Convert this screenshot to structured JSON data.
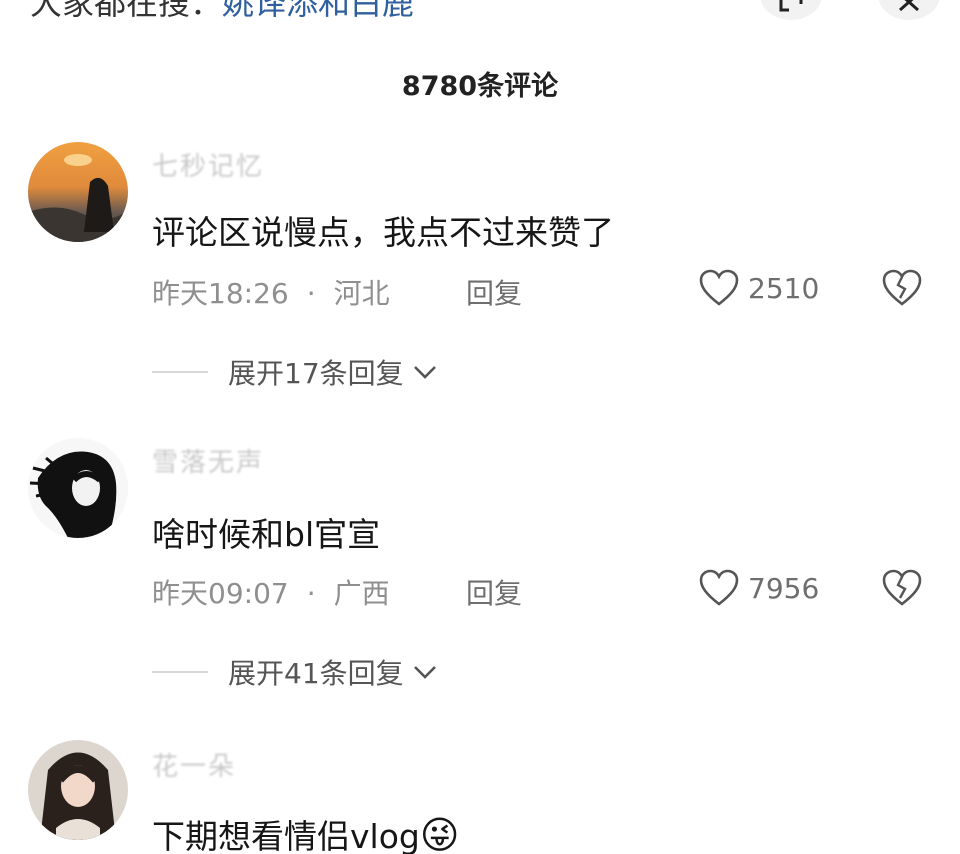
{
  "topbar": {
    "search_prefix": "大家都在搜：",
    "search_keyword": "姚译添和白鹿",
    "search_icon": "search-icon",
    "expand_icon": "expand-icon",
    "close_icon": "close-icon"
  },
  "comment_count": "8780条评论",
  "comments": [
    {
      "username": "七秒记忆",
      "text": "评论区说慢点，我点不过来赞了",
      "time": "昨天18:26",
      "location": "河北",
      "reply_label": "回复",
      "likes": "2510",
      "expand_label": "展开17条回复"
    },
    {
      "username": "雪落无声",
      "text": "啥时候和bl官宣",
      "time": "昨天09:07",
      "location": "广西",
      "reply_label": "回复",
      "likes": "7956",
      "expand_label": "展开41条回复"
    },
    {
      "username": "花一朵",
      "text": "下期想看情侣vlog",
      "emoji": "😜"
    }
  ],
  "meta_separator": "·"
}
